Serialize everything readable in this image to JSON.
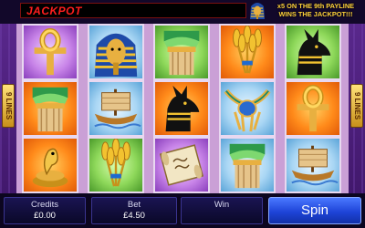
{
  "top_bar": {
    "jackpot_label": "JACKPOT",
    "jackpot_value": "",
    "promo_line1": "x5 ON THE 9th PAYLINE",
    "promo_line2": "WINS THE JACKPOT!!!"
  },
  "side_markers": {
    "left": "9 LINES",
    "right": "9 LINES"
  },
  "reels": [
    [
      "ankh",
      "column",
      "cobra"
    ],
    [
      "pharaoh",
      "ship",
      "wheat"
    ],
    [
      "column",
      "anubis",
      "scroll"
    ],
    [
      "wheat",
      "scarab-necklace",
      "column"
    ],
    [
      "anubis",
      "ankh",
      "ship"
    ]
  ],
  "cell_backgrounds": [
    [
      "purple",
      "orange",
      "orange"
    ],
    [
      "blue",
      "blue",
      "green"
    ],
    [
      "green",
      "orange",
      "purple"
    ],
    [
      "orange",
      "blue",
      "blue"
    ],
    [
      "green",
      "orange",
      "blue"
    ]
  ],
  "controls": {
    "credits_label": "Credits",
    "credits_value": "£0.00",
    "bet_label": "Bet",
    "bet_value": "£4.50",
    "win_label": "Win",
    "win_value": "",
    "spin_label": "Spin"
  },
  "colors": {
    "jackpot_red": "#ff1e1e",
    "promo_gold": "#ffd23a",
    "spin_blue": "#1e44d8",
    "panel_navy": "#1a1452"
  }
}
